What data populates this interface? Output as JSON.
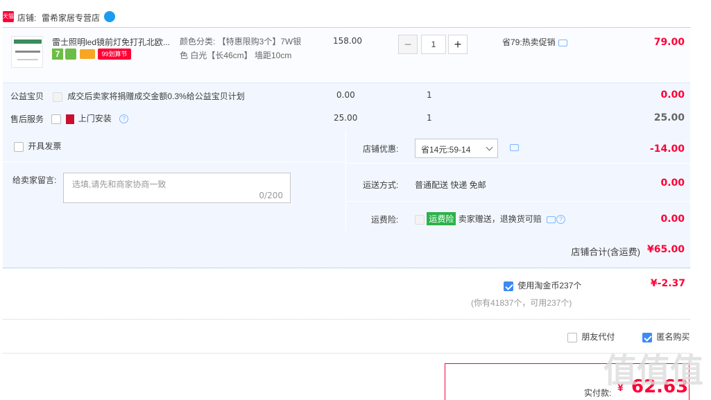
{
  "header": {
    "tmall_badge": "天猫",
    "shop_prefix": "店铺:",
    "shop_name": "雷希家居专营店"
  },
  "item": {
    "title": "雷士照明led镜前灯免打孔北欧...",
    "badges": {
      "seven": "7",
      "promo": "99划算节"
    },
    "sku": "颜色分类: 【特惠限购3个】7W银色 白光【长46cm】 墙距10cm",
    "unit_price": "158.00",
    "quantity": "1",
    "minus": "−",
    "plus": "+",
    "saving": "省79:热卖促销",
    "total": "79.00"
  },
  "charity": {
    "label": "公益宝贝",
    "text": "成交后卖家将捐赠成交金额0.3%给公益宝贝计划",
    "price": "0.00",
    "qty": "1",
    "total": "0.00"
  },
  "after_sale": {
    "label": "售后服务",
    "text": "上门安装",
    "price": "25.00",
    "qty": "1",
    "total": "25.00"
  },
  "invoice": {
    "label": "开具发票"
  },
  "message": {
    "label": "给卖家留言:",
    "placeholder": "选填,请先和商家协商一致",
    "counter": "0/200"
  },
  "shop_discount": {
    "label": "店铺优惠:",
    "selected": "省14元:59-14",
    "amount": "-14.00"
  },
  "shipping": {
    "label": "运送方式:",
    "text": "普通配送 快递 免邮",
    "amount": "0.00"
  },
  "insurance": {
    "label": "运费险:",
    "tag": "运费险",
    "text": "卖家赠送，退换货可赔",
    "amount": "0.00"
  },
  "shop_total": {
    "label": "店铺合计(含运费)",
    "amount": "¥65.00"
  },
  "coins": {
    "label": "使用淘金币237个",
    "note": "(你有41837个，可用237个)",
    "amount": "¥-2.37"
  },
  "options": {
    "friend_pay": "朋友代付",
    "anonymous": "匿名购买"
  },
  "payment": {
    "label": "实付款:",
    "currency": "¥",
    "amount": "62.63"
  },
  "watermark": "值值值",
  "colors": {
    "accent": "#ff0036",
    "block_bg": "#f2f7ff",
    "link": "#3d8af7"
  }
}
